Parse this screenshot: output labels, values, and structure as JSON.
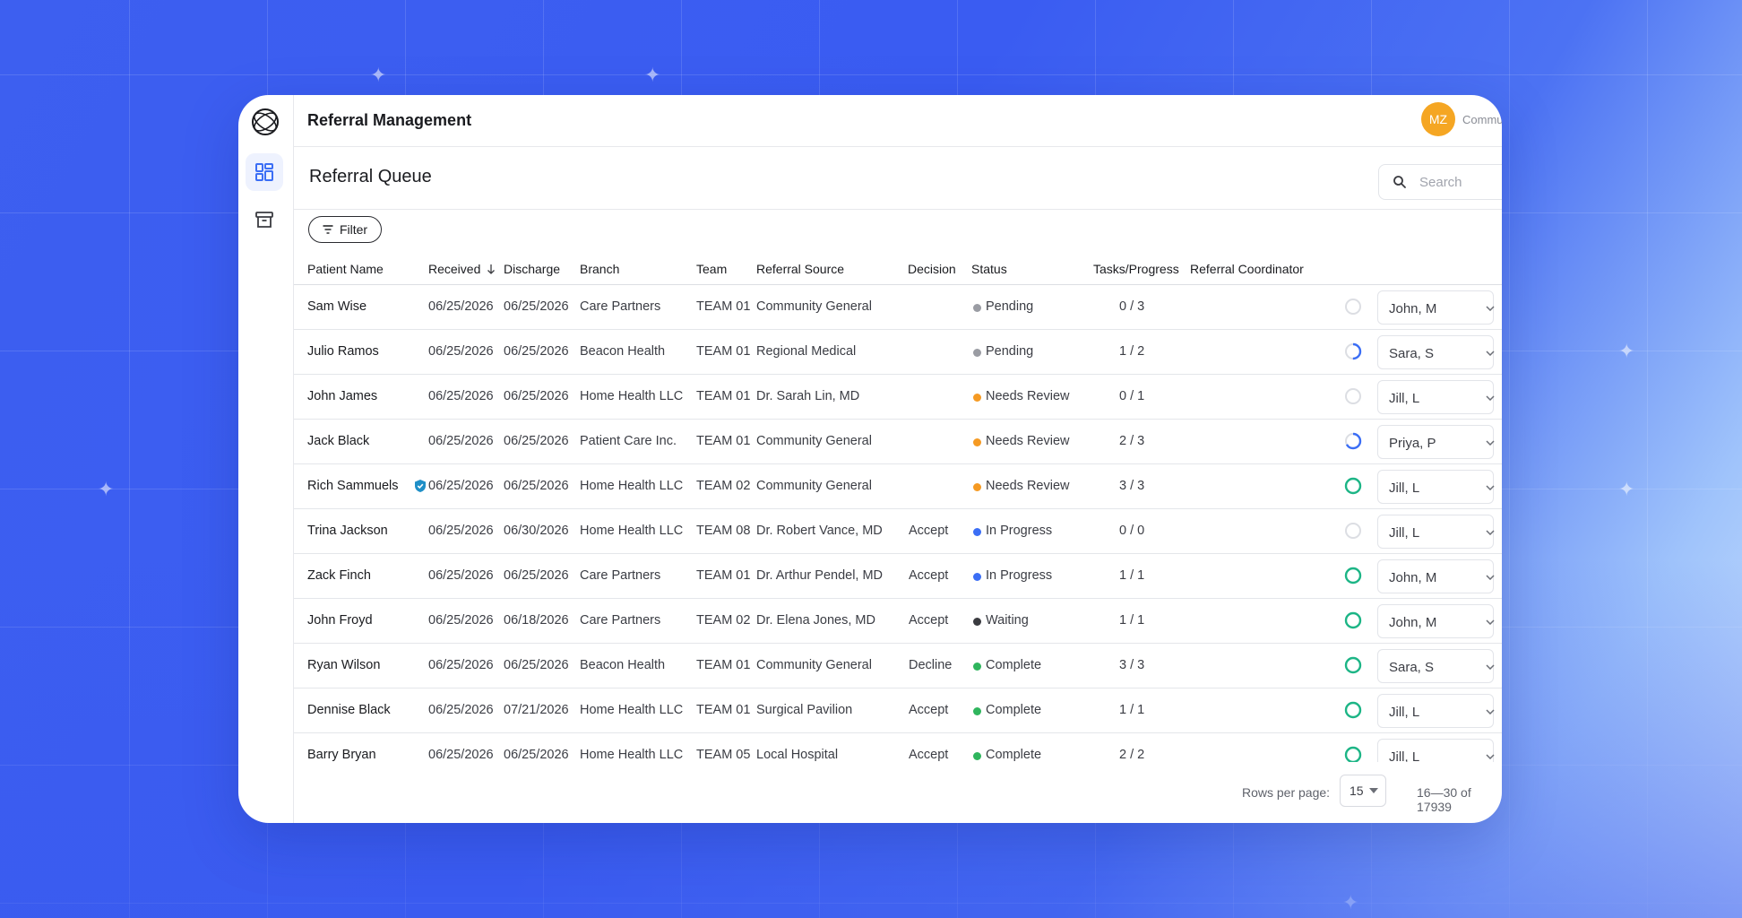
{
  "app": {
    "title": "Referral Management",
    "user_initials": "MZ",
    "org_name": "Community General"
  },
  "page": {
    "title": "Referral Queue",
    "search_placeholder": "Search",
    "filter_label": "Filter"
  },
  "table": {
    "columns": [
      "Patient Name",
      "Received",
      "Discharge",
      "Branch",
      "Team",
      "Referral Source",
      "Decision",
      "Status",
      "Tasks/Progress",
      "Referral Coordinator"
    ],
    "sort_column": "Received",
    "rows": [
      {
        "name": "Sam Wise",
        "received": "06/25/2026",
        "discharge": "06/25/2026",
        "branch": "Care Partners",
        "team": "TEAM 01",
        "source": "Community General",
        "decision": "",
        "status": "Pending",
        "tasks": "0 / 3",
        "done": 0,
        "total": 3,
        "coordinator": "John, M",
        "verified": false
      },
      {
        "name": "Julio Ramos",
        "received": "06/25/2026",
        "discharge": "06/25/2026",
        "branch": "Beacon Health",
        "team": "TEAM 01",
        "source": "Regional Medical",
        "decision": "",
        "status": "Pending",
        "tasks": "1 / 2",
        "done": 1,
        "total": 2,
        "coordinator": "Sara, S",
        "verified": false
      },
      {
        "name": "John James",
        "received": "06/25/2026",
        "discharge": "06/25/2026",
        "branch": "Home Health LLC",
        "team": "TEAM 01",
        "source": "Dr. Sarah Lin, MD",
        "decision": "",
        "status": "Needs Review",
        "tasks": "0 / 1",
        "done": 0,
        "total": 1,
        "coordinator": "Jill, L",
        "verified": false
      },
      {
        "name": "Jack Black",
        "received": "06/25/2026",
        "discharge": "06/25/2026",
        "branch": "Patient Care Inc.",
        "team": "TEAM 01",
        "source": "Community General",
        "decision": "",
        "status": "Needs Review",
        "tasks": "2 / 3",
        "done": 2,
        "total": 3,
        "coordinator": "Priya, P",
        "verified": false
      },
      {
        "name": "Rich Sammuels",
        "received": "06/25/2026",
        "discharge": "06/25/2026",
        "branch": "Home Health LLC",
        "team": "TEAM 02",
        "source": "Community General",
        "decision": "",
        "status": "Needs Review",
        "tasks": "3 / 3",
        "done": 3,
        "total": 3,
        "coordinator": "Jill, L",
        "verified": true
      },
      {
        "name": "Trina Jackson",
        "received": "06/25/2026",
        "discharge": "06/30/2026",
        "branch": "Home Health LLC",
        "team": "TEAM 08",
        "source": "Dr. Robert Vance, MD",
        "decision": "Accept",
        "status": "In Progress",
        "tasks": "0 / 0",
        "done": 0,
        "total": 0,
        "coordinator": "Jill, L",
        "verified": false
      },
      {
        "name": "Zack Finch",
        "received": "06/25/2026",
        "discharge": "06/25/2026",
        "branch": "Care Partners",
        "team": "TEAM 01",
        "source": "Dr. Arthur Pendel, MD",
        "decision": "Accept",
        "status": "In Progress",
        "tasks": "1 / 1",
        "done": 1,
        "total": 1,
        "coordinator": "John, M",
        "verified": false
      },
      {
        "name": "John Froyd",
        "received": "06/25/2026",
        "discharge": "06/18/2026",
        "branch": "Care Partners",
        "team": "TEAM 02",
        "source": "Dr. Elena Jones, MD",
        "decision": "Accept",
        "status": "Waiting",
        "tasks": "1 / 1",
        "done": 1,
        "total": 1,
        "coordinator": "John, M",
        "verified": false
      },
      {
        "name": "Ryan Wilson",
        "received": "06/25/2026",
        "discharge": "06/25/2026",
        "branch": "Beacon Health",
        "team": "TEAM 01",
        "source": "Community General",
        "decision": "Decline",
        "status": "Complete",
        "tasks": "3 / 3",
        "done": 3,
        "total": 3,
        "coordinator": "Sara, S",
        "verified": false
      },
      {
        "name": "Dennise Black",
        "received": "06/25/2026",
        "discharge": "07/21/2026",
        "branch": "Home Health LLC",
        "team": "TEAM 01",
        "source": "Surgical Pavilion",
        "decision": "Accept",
        "status": "Complete",
        "tasks": "1 / 1",
        "done": 1,
        "total": 1,
        "coordinator": "Jill, L",
        "verified": false
      },
      {
        "name": "Barry Bryan",
        "received": "06/25/2026",
        "discharge": "06/25/2026",
        "branch": "Home Health LLC",
        "team": "TEAM 05",
        "source": "Local Hospital",
        "decision": "Accept",
        "status": "Complete",
        "tasks": "2 / 2",
        "done": 2,
        "total": 2,
        "coordinator": "Jill, L",
        "verified": false
      }
    ]
  },
  "status_colors": {
    "Pending": "#9a9ca3",
    "Needs Review": "#f59a23",
    "In Progress": "#3b6ef5",
    "Waiting": "#3a3b40",
    "Complete": "#2fb55d"
  },
  "progress_colors": {
    "empty": "#dcdee3",
    "partial": "#3b6ef5",
    "complete": "#1db586"
  },
  "pagination": {
    "rows_per_page_label": "Rows per page:",
    "rows_per_page": "15",
    "range": "16—30 of 17939"
  }
}
